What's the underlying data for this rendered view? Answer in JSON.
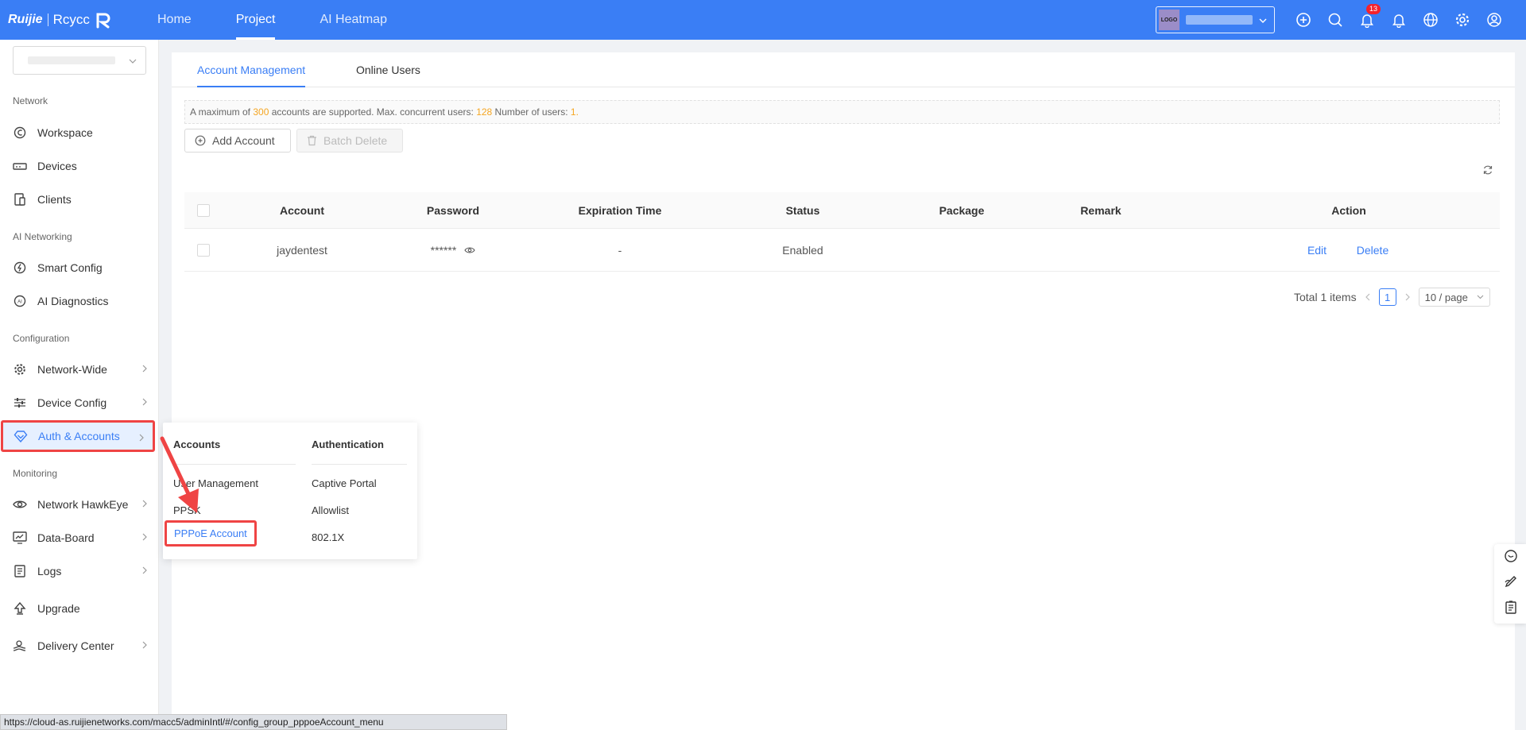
{
  "header": {
    "brand": "Ruijie",
    "brand_sub": "Rcycc",
    "nav": [
      {
        "label": "Home"
      },
      {
        "label": "Project"
      },
      {
        "label": "AI Heatmap"
      }
    ],
    "tenant_logo": "LOGO",
    "notification_count": "13",
    "accent": "#3a7ef5"
  },
  "sidebar": {
    "sections": {
      "network": "Network",
      "ai": "AI Networking",
      "config": "Configuration",
      "monitoring": "Monitoring"
    },
    "items": [
      {
        "label": "Workspace",
        "icon": "workspace-icon"
      },
      {
        "label": "Devices",
        "icon": "devices-icon"
      },
      {
        "label": "Clients",
        "icon": "clients-icon"
      },
      {
        "label": "Smart Config",
        "icon": "smart-config-icon"
      },
      {
        "label": "AI Diagnostics",
        "icon": "ai-diagnostics-icon"
      },
      {
        "label": "Network-Wide",
        "icon": "gear-icon"
      },
      {
        "label": "Device Config",
        "icon": "sliders-icon"
      },
      {
        "label": "Auth & Accounts",
        "icon": "shield-icon"
      },
      {
        "label": "Network HawkEye",
        "icon": "eye-icon"
      },
      {
        "label": "Data-Board",
        "icon": "dashboard-icon"
      },
      {
        "label": "Logs",
        "icon": "logs-icon"
      },
      {
        "label": "Upgrade",
        "icon": "upgrade-icon"
      },
      {
        "label": "Delivery Center",
        "icon": "delivery-icon"
      }
    ]
  },
  "tabs": [
    {
      "label": "Account Management"
    },
    {
      "label": "Online Users"
    }
  ],
  "notice": {
    "p1": "A maximum of ",
    "max_accounts": "300",
    "p2": " accounts are supported. Max. concurrent users: ",
    "max_concurrent": "128",
    "p3": " Number of users: ",
    "users": "1",
    "p4": "."
  },
  "toolbar": {
    "add": "Add Account",
    "batch_delete": "Batch Delete"
  },
  "table": {
    "columns": [
      "Account",
      "Password",
      "Expiration Time",
      "Status",
      "Package",
      "Remark",
      "Action"
    ],
    "rows": [
      {
        "account": "jaydentest",
        "password": "******",
        "expiration": "-",
        "status": "Enabled",
        "package": "",
        "remark": "",
        "edit": "Edit",
        "delete": "Delete"
      }
    ]
  },
  "pagination": {
    "total": "Total 1 items",
    "current": "1",
    "page_size": "10 / page"
  },
  "popup": {
    "accounts_title": "Accounts",
    "auth_title": "Authentication",
    "accounts_items": [
      "User Management",
      "PPSK",
      "PPPoE Account"
    ],
    "auth_items": [
      "Captive Portal",
      "Allowlist",
      "802.1X"
    ]
  },
  "statusbar": {
    "url": "https://cloud-as.ruijienetworks.com/macc5/adminIntl/#/config_group_pppoeAccount_menu"
  }
}
